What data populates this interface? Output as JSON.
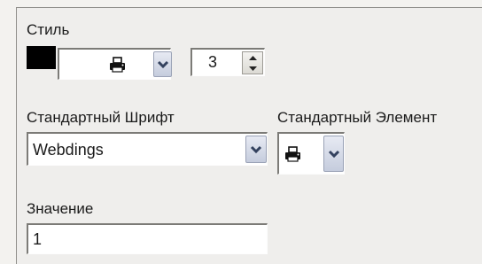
{
  "style": {
    "label": "Стиль",
    "color": "#000000",
    "element_glyph": "printer-glyph",
    "width_value": "3"
  },
  "font": {
    "label": "Стандартный Шрифт",
    "selected": "Webdings"
  },
  "element": {
    "label": "Стандартный Элемент",
    "glyph": "printer-glyph"
  },
  "value": {
    "label": "Значение",
    "text": "1"
  },
  "colors": {
    "dropdown_button": "#c5ccdd",
    "swatch": "#000000"
  }
}
